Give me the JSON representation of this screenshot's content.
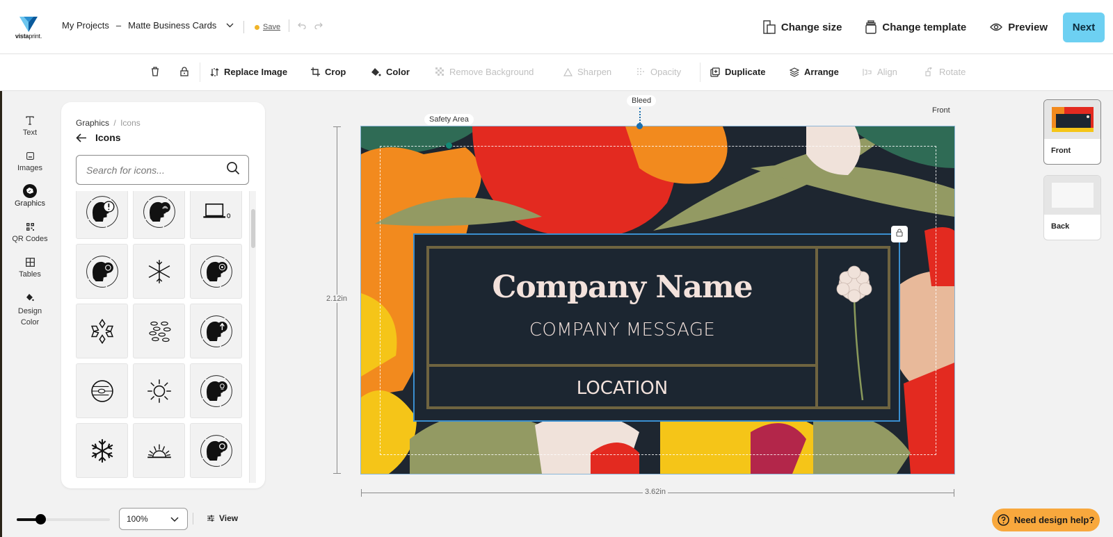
{
  "app": {
    "brand": "vistaprint",
    "brand_suffix": "print."
  },
  "header": {
    "breadcrumb_root": "My Projects",
    "breadcrumb_separator": "–",
    "project_name": "Matte Business Cards",
    "save_label": "Save",
    "save_status_color": "#f0b429",
    "actions": {
      "change_size": "Change size",
      "change_template": "Change template",
      "preview": "Preview",
      "next": "Next"
    },
    "next_color": "#6dd0f2"
  },
  "toolbar": {
    "replace_image": "Replace Image",
    "crop": "Crop",
    "color": "Color",
    "remove_background": "Remove Background",
    "sharpen": "Sharpen",
    "opacity": "Opacity",
    "duplicate": "Duplicate",
    "arrange": "Arrange",
    "align": "Align",
    "rotate": "Rotate"
  },
  "rail": {
    "items": [
      {
        "label": "Text",
        "icon": "text-icon"
      },
      {
        "label": "Images",
        "icon": "image-icon"
      },
      {
        "label": "Graphics",
        "icon": "graphics-icon",
        "active": true
      },
      {
        "label": "QR Codes",
        "icon": "qr-code-icon"
      },
      {
        "label": "Tables",
        "icon": "table-icon"
      },
      {
        "label": "Design\nColor",
        "icon": "paint-bucket-icon"
      }
    ]
  },
  "panel": {
    "crumb_parent": "Graphics",
    "crumb_sep": "/",
    "crumb_current": "Icons",
    "title": "Icons",
    "search_placeholder": "Search for icons...",
    "search_value": "",
    "icons": [
      "head-exclamation-icon",
      "head-lotus-icon",
      "laptop-mouse-icon",
      "head-biohazard-icon",
      "snowflake-thin-icon",
      "head-target-icon",
      "snowflake-outline-icon",
      "fish-school-icon",
      "head-arrow-up-icon",
      "planet-jupiter-icon",
      "sun-icon",
      "head-lightbulb-icon",
      "snowflake-bold-icon",
      "sunrise-icon",
      "head-eye-icon"
    ],
    "scroll_position": 0.06
  },
  "canvas": {
    "side_label": "Front",
    "bleed_label": "Bleed",
    "safety_label": "Safety Area",
    "height_label": "2.12in",
    "width_label": "3.62in"
  },
  "card": {
    "company_name": "Company Name",
    "company_message": "COMPANY MESSAGE",
    "location": "LOCATION",
    "text_color": "#f3e2dc",
    "background": "#1c2631",
    "frame_color": "#6f6440"
  },
  "pages": [
    {
      "label": "Front",
      "active": true
    },
    {
      "label": "Back",
      "active": false
    }
  ],
  "bottom": {
    "zoom_level": "100%",
    "zoom_slider_fraction": 0.26,
    "view_label": "View",
    "help_label": "Need design help?",
    "help_color": "#f8a83d"
  }
}
